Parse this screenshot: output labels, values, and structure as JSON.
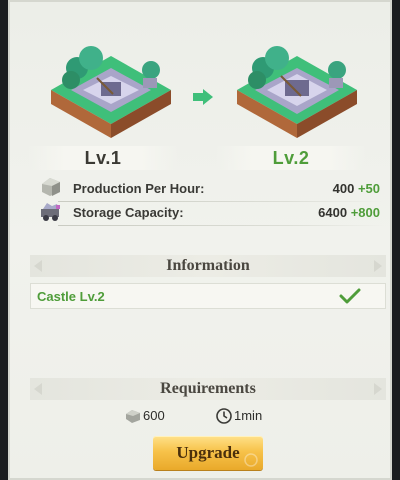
{
  "levels": {
    "current": "Lv.1",
    "next": "Lv.2"
  },
  "stats": [
    {
      "label": "Production Per Hour:",
      "base": "400",
      "bonus": "+50",
      "icon": "stone-ore-icon"
    },
    {
      "label": "Storage Capacity:",
      "base": "6400",
      "bonus": "+800",
      "icon": "ore-cart-icon"
    }
  ],
  "information": {
    "header": "Information",
    "item": "Castle Lv.2",
    "status_icon": "checkmark-icon"
  },
  "requirements": {
    "header": "Requirements",
    "cost": "600",
    "cost_icon": "stone-icon",
    "time": "1min",
    "time_icon": "clock-icon"
  },
  "actions": {
    "upgrade": "Upgrade"
  },
  "colors": {
    "accent_green": "#4f9d3a",
    "button_gold": "#f7c24a"
  }
}
